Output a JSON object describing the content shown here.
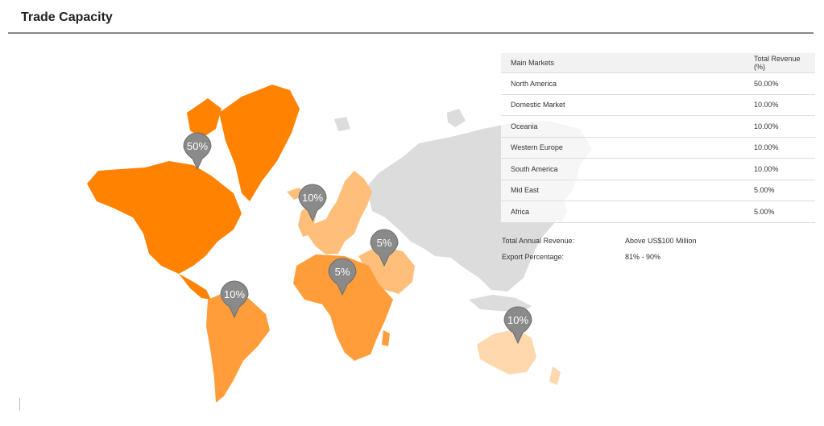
{
  "header": {
    "title": "Trade Capacity"
  },
  "table": {
    "columns": [
      "Main Markets",
      "Total Revenue (%)"
    ],
    "rows": [
      {
        "market": "North America",
        "revenue": "50.00%"
      },
      {
        "market": "Domestic Market",
        "revenue": "10.00%"
      },
      {
        "market": "Oceania",
        "revenue": "10.00%"
      },
      {
        "market": "Western Europe",
        "revenue": "10.00%"
      },
      {
        "market": "South America",
        "revenue": "10.00%"
      },
      {
        "market": "Mid East",
        "revenue": "5.00%"
      },
      {
        "market": "Africa",
        "revenue": "5.00%"
      }
    ]
  },
  "summary": {
    "annual_revenue_label": "Total Annual Revenue:",
    "annual_revenue_value": "Above US$100 Million",
    "export_label": "Export Percentage:",
    "export_value": "81% - 90%"
  },
  "map": {
    "pins": [
      {
        "region": "North America",
        "label": "50%"
      },
      {
        "region": "Western Europe",
        "label": "10%"
      },
      {
        "region": "Mid East",
        "label": "5%"
      },
      {
        "region": "Africa",
        "label": "5%"
      },
      {
        "region": "South America",
        "label": "10%"
      },
      {
        "region": "Oceania",
        "label": "10%"
      }
    ],
    "colors": {
      "north_america": "#ff8200",
      "south_america_africa": "#ff9d3a",
      "europe_mideast": "#ffbe7a",
      "oceania": "#ffd8ae",
      "inactive": "#dcdcdc",
      "pin": "#8a8a8a"
    }
  }
}
